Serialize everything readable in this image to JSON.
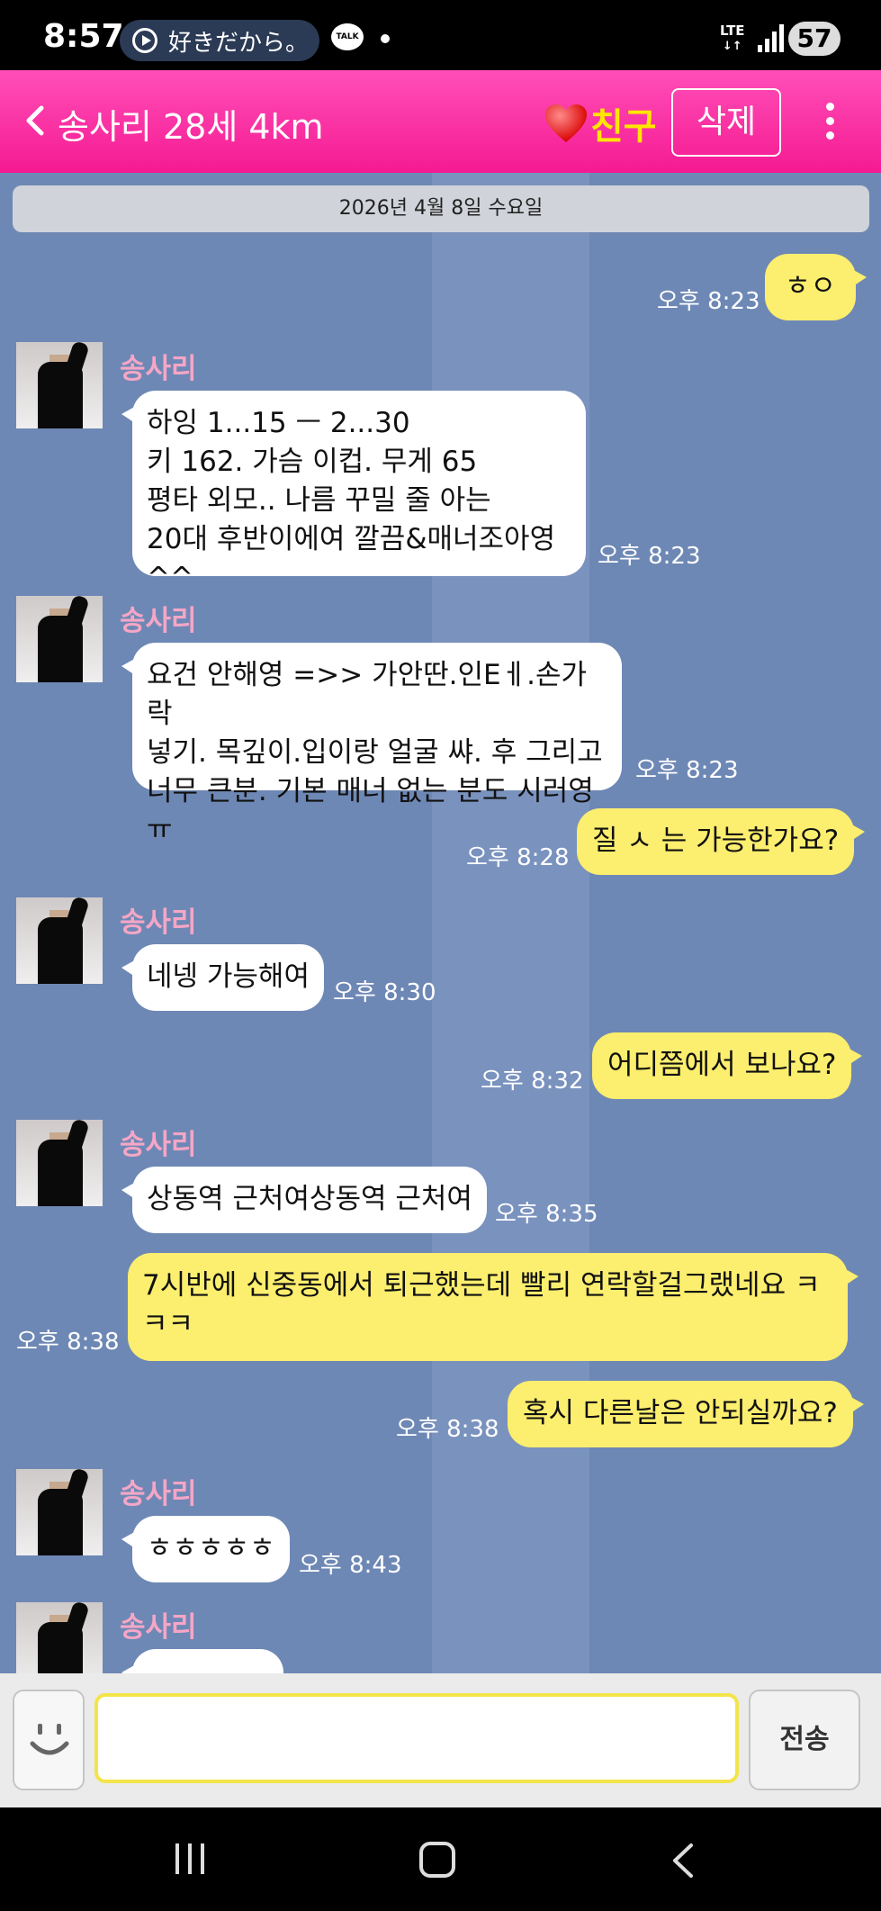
{
  "status_bar": {
    "time": "8:57",
    "music_text": "好きだから。",
    "talk_badge": "TALK",
    "network": "LTE",
    "battery": "57"
  },
  "header": {
    "title": "송사리 28세 4km",
    "friend_label": "친구",
    "delete_label": "삭제"
  },
  "chat": {
    "date": "2026년 4월 8일 수요일",
    "messages": [
      {
        "from": "me",
        "text": "ㅎㅇ",
        "time": "오후 8:23"
      },
      {
        "from": "other",
        "sender": "송사리",
        "text": "하잉 1...15 ㅡ 2...30\n키 162. 가슴 이컵. 무게 65\n평타 외모.. 나름 꾸밀 줄 아는\n20대 후반이에여 깔끔&매너조아영^^",
        "time": "오후 8:23"
      },
      {
        "from": "other",
        "sender": "송사리",
        "text": "요건 안해영 =>> 가안딴.인Eㅔ.손가락\n넣기. 목깊이.입이랑 얼굴 쌰. 후 그리고\n너무 큰분. 기본 매너 없는 분도 시러영ㅠ",
        "time": "오후 8:23"
      },
      {
        "from": "me",
        "text": "질 ㅅ 는 가능한가요?",
        "time": "오후 8:28"
      },
      {
        "from": "other",
        "sender": "송사리",
        "text": "네넹 가능해여",
        "time": "오후 8:30"
      },
      {
        "from": "me",
        "text": "어디쯤에서 보나요?",
        "time": "오후 8:32"
      },
      {
        "from": "other",
        "sender": "송사리",
        "text": "상동역 근처여상동역 근처여",
        "time": "오후 8:35"
      },
      {
        "from": "me",
        "text": "7시반에 신중동에서 퇴근했는데 빨리 연락할걸그랬네요 ㅋ\nㅋㅋ",
        "time": "오후 8:38"
      },
      {
        "from": "me",
        "text": "혹시 다른날은 안되실까요?",
        "time": "오후 8:38"
      },
      {
        "from": "other",
        "sender": "송사리",
        "text": "ㅎㅎㅎㅎㅎ",
        "time": "오후 8:43"
      },
      {
        "from": "other",
        "sender": "송사리",
        "text": "",
        "time": ""
      }
    ]
  },
  "input": {
    "value": "",
    "placeholder": "",
    "send_label": "전송"
  },
  "icons": {
    "back": "chevron-left-icon",
    "heart": "heart-icon",
    "menu": "more-vertical-icon",
    "emoji": "smiley-icon",
    "nav": [
      "recents-icon",
      "home-icon",
      "back-icon"
    ]
  },
  "colors": {
    "header": "#f51a92",
    "friend_label": "#ffe600",
    "chat_background": "#6e88b5",
    "outgoing_bubble": "#fcee6e",
    "incoming_bubble": "#ffffff",
    "sender_name": "#f5a6c6"
  }
}
